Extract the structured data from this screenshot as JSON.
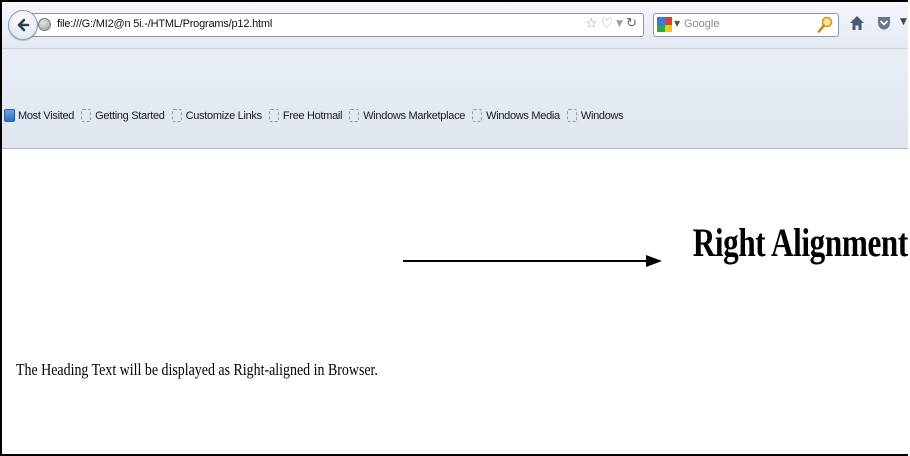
{
  "navbar": {
    "url": "file:///G:/MI2@n 5i.-/HTML/Programs/p12.html",
    "search_placeholder": "Google"
  },
  "bookmarks": [
    {
      "label": "Most Visited",
      "icon": "folder-icon"
    },
    {
      "label": "Getting Started",
      "icon": "page-icon"
    },
    {
      "label": "Customize Links",
      "icon": "page-icon"
    },
    {
      "label": "Free Hotmail",
      "icon": "page-icon"
    },
    {
      "label": "Windows Marketplace",
      "icon": "page-icon"
    },
    {
      "label": "Windows Media",
      "icon": "page-icon"
    },
    {
      "label": "Windows",
      "icon": "page-icon"
    }
  ],
  "page": {
    "heading": "Right Alignment",
    "paragraph": "The Heading Text will be displayed as Right-aligned in Browser."
  },
  "colors": {
    "toolbar_bg": "#e4eaf3",
    "url_border": "#8b97a8"
  }
}
